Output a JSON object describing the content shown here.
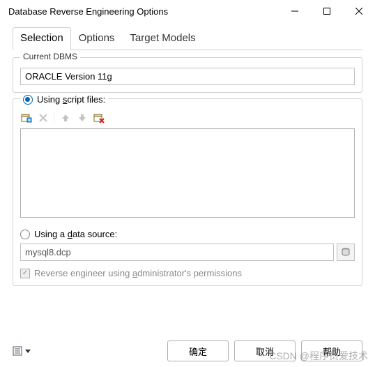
{
  "window": {
    "title": "Database Reverse Engineering Options"
  },
  "tabs": {
    "selection": "Selection",
    "options": "Options",
    "target_models": "Target Models"
  },
  "dbms": {
    "legend": "Current DBMS",
    "value": "ORACLE Version 11g"
  },
  "script_section": {
    "radio_prefix": "Using ",
    "radio_underline": "s",
    "radio_suffix": "cript files:"
  },
  "datasource_section": {
    "radio_prefix": "Using a ",
    "radio_underline": "d",
    "radio_suffix": "ata source:",
    "value": "mysql8.dcp",
    "checkbox_prefix": "Reverse engineer using ",
    "checkbox_underline": "a",
    "checkbox_suffix": "dministrator's permissions"
  },
  "footer": {
    "ok": "确定",
    "cancel": "取消",
    "help": "帮助"
  },
  "watermark": "CSDN @程序员爱技术"
}
